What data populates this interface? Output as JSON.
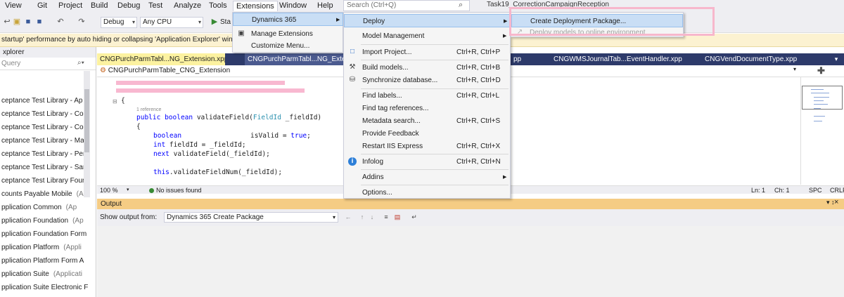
{
  "menubar": {
    "items": [
      "View",
      "Git",
      "Project",
      "Build",
      "Debug",
      "Test",
      "Analyze",
      "Tools",
      "Extensions",
      "Window",
      "Help"
    ],
    "search_placeholder": "Search (Ctrl+Q)",
    "task_title": "Task19_CorrectionCampaignReception"
  },
  "toolbar": {
    "config": "Debug",
    "platform": "Any CPU",
    "start_label": "Sta"
  },
  "infobar": {
    "text": "startup' performance by auto hiding or collapsing 'Application Explorer' win"
  },
  "explorer": {
    "title": "xplorer",
    "search_placeholder": "Query",
    "items": [
      {
        "name": "ceptance Test Library - Ap",
        "tag": ""
      },
      {
        "name": "ceptance Test Library - Co",
        "tag": ""
      },
      {
        "name": "ceptance Test Library - Co",
        "tag": ""
      },
      {
        "name": "ceptance Test Library - Ma",
        "tag": ""
      },
      {
        "name": "ceptance Test Library - Per",
        "tag": ""
      },
      {
        "name": "ceptance Test Library - Sar",
        "tag": ""
      },
      {
        "name": "ceptance Test Library Four",
        "tag": ""
      },
      {
        "name": "counts Payable Mobile",
        "tag": "(A"
      },
      {
        "name": "pplication Common",
        "tag": "(Ap"
      },
      {
        "name": "pplication Foundation",
        "tag": "(Ap"
      },
      {
        "name": "pplication Foundation Form",
        "tag": ""
      },
      {
        "name": "pplication Platform",
        "tag": "(Appli"
      },
      {
        "name": "pplication Platform Form A",
        "tag": ""
      },
      {
        "name": "pplication Suite",
        "tag": "(Applicati"
      },
      {
        "name": "pplication Suite Electronic F",
        "tag": ""
      }
    ]
  },
  "doctabs": [
    "CNGPurchParmTabl...NG_Extension.xpp*",
    "CNGPurchParmTabl...NG_Extension",
    "pp",
    "CNGWMSJournalTab...EventHandler.xpp",
    "CNGVendDocumentType.xpp"
  ],
  "navbar": {
    "class_name": "CNGPurchParmTable_CNG_Extension"
  },
  "code": {
    "brace": "{",
    "ref": "1 reference",
    "line1_kw1": "public",
    "line1_kw2": "boolean",
    "line1_rest": " validateField(",
    "line1_type": "FieldId",
    "line1_end": " _fieldId)",
    "line2": "{",
    "line3_kw": "boolean",
    "line3_var": "isValid",
    "line3_eq": " = ",
    "line3_val": "true",
    "line3_end": ";",
    "line4_kw": "int",
    "line4_rest": " fieldId = _fieldId;",
    "line5_kw": "next",
    "line5_rest": " validateField(_fieldId);",
    "line6_kw": "this",
    "line6_rest": ".validateFieldNum(_fieldId);"
  },
  "editor_status": {
    "zoom": "100 %",
    "issues": "No issues found",
    "ln": "Ln: 1",
    "ch": "Ch: 1",
    "spc": "SPC",
    "crlf": "CRLF"
  },
  "output": {
    "title": "Output",
    "show_from_label": "Show output from:",
    "source": "Dynamics 365 Create Package"
  },
  "menu_extensions": {
    "items": [
      {
        "label": "Dynamics 365"
      },
      {
        "label": "Manage Extensions"
      },
      {
        "label": "Customize Menu..."
      }
    ]
  },
  "menu_dynamics": {
    "items": [
      {
        "label": "Deploy",
        "shortcut": ""
      },
      {
        "label": "Model Management",
        "shortcut": ""
      },
      {
        "label": "Import Project...",
        "shortcut": "Ctrl+R, Ctrl+P"
      },
      {
        "label": "Build models...",
        "shortcut": "Ctrl+R, Ctrl+B"
      },
      {
        "label": "Synchronize database...",
        "shortcut": "Ctrl+R, Ctrl+D"
      },
      {
        "label": "Find labels...",
        "shortcut": "Ctrl+R, Ctrl+L"
      },
      {
        "label": "Find tag references...",
        "shortcut": ""
      },
      {
        "label": "Metadata search...",
        "shortcut": "Ctrl+R, Ctrl+S"
      },
      {
        "label": "Provide Feedback",
        "shortcut": ""
      },
      {
        "label": "Restart IIS Express",
        "shortcut": "Ctrl+R, Ctrl+X"
      },
      {
        "label": "Infolog",
        "shortcut": "Ctrl+R, Ctrl+N"
      },
      {
        "label": "Addins",
        "shortcut": ""
      },
      {
        "label": "Options...",
        "shortcut": ""
      }
    ]
  },
  "menu_deploy": {
    "items": [
      {
        "label": "Create Deployment Package..."
      },
      {
        "label": "Deploy models to online environment"
      }
    ]
  },
  "colors": {
    "accent": "#2d3a6a",
    "output_title": "#f5cc84",
    "infobar": "#fcf2d1",
    "menu_highlight": "#c9def5",
    "annotation": "#f7b7cc"
  }
}
